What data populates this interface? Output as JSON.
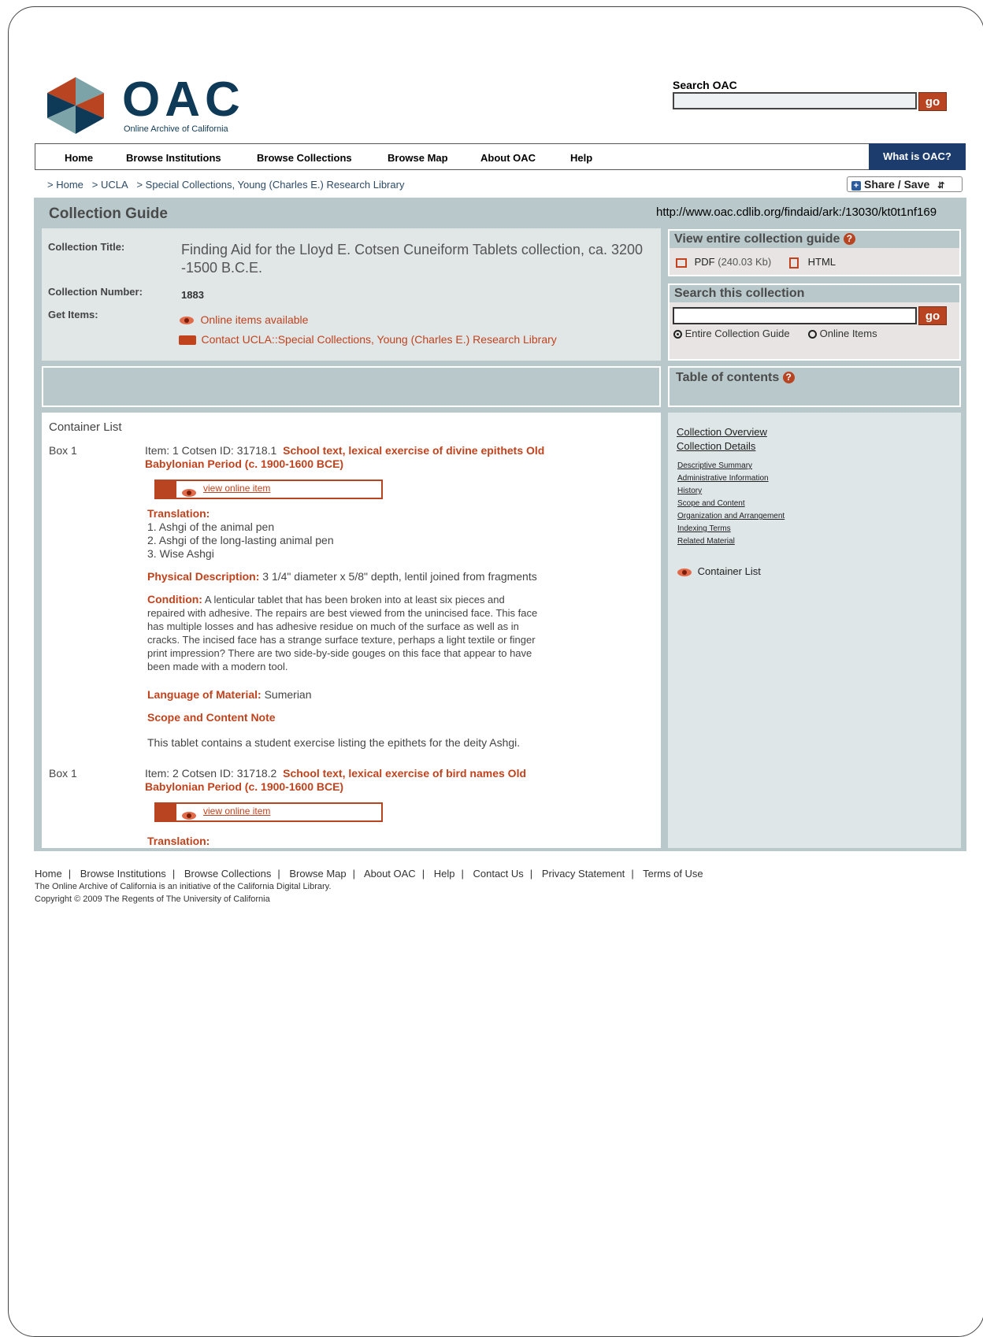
{
  "header": {
    "logo_text": "OAC",
    "logo_subtitle": "Online Archive of California",
    "search_label": "Search OAC",
    "search_placeholder": "",
    "go_label": "go"
  },
  "nav": {
    "items": [
      "Home",
      "Browse Institutions",
      "Browse Collections",
      "Browse Map",
      "About OAC",
      "Help"
    ],
    "what_is": "What is OAC?"
  },
  "breadcrumb": [
    "> Home",
    "> UCLA",
    "> Special Collections, Young (Charles E.) Research Library"
  ],
  "share_label": "Share / Save",
  "guide": {
    "heading": "Collection Guide",
    "url": "http://www.oac.cdlib.org/findaid/ark:/13030/kt0t1nf169",
    "title_label": "Collection Title:",
    "title_value": "Finding Aid for the Lloyd E. Cotsen Cuneiform Tablets collection, ca. 3200 -1500 B.C.E.",
    "number_label": "Collection Number:",
    "number_value": "1883",
    "get_items_label": "Get Items:",
    "online_items": "Online items available",
    "contact": "Contact UCLA::Special Collections, Young (Charles E.) Research Library"
  },
  "view_guide": {
    "heading": "View entire collection guide",
    "pdf_label": "PDF",
    "pdf_size": "(240.03 Kb)",
    "html_label": "HTML"
  },
  "search_collection": {
    "heading": "Search this collection",
    "go_label": "go",
    "option1": "Entire Collection Guide",
    "option2": "Online Items"
  },
  "toc": {
    "heading": "Table of contents",
    "overview": "Collection Overview",
    "details": "Collection Details",
    "sub_items": [
      "Descriptive Summary",
      "Administrative Information",
      "History",
      "Scope and Content",
      "Organization and Arrangement",
      "Indexing Terms",
      "Related Material"
    ],
    "container_list": "Container List"
  },
  "container": {
    "heading": "Container List",
    "items": [
      {
        "box": "Box 1",
        "item_prefix": "Item: 1 Cotsen ID: 31718.1",
        "title_line1": "School text, lexical exercise of divine epithets Old",
        "title_line2": "Babylonian Period (c. 1900-1600 BCE)",
        "view_label": "view online item",
        "translation_label": "Translation:",
        "translation_lines": [
          "1. Ashgi of the animal pen",
          "2. Ashgi of the long-lasting animal pen",
          "3. Wise Ashgi"
        ],
        "physical_label": "Physical Description:",
        "physical_value": "3 1/4\" diameter x 5/8\" depth, lentil joined from fragments",
        "condition_label": "Condition:",
        "condition_lines": [
          "A lenticular tablet that has been broken into at least six pieces and",
          "repaired with adhesive. The repairs are best viewed from the unincised face. This face",
          "has multiple losses and has adhesive residue on much of the surface as well as in",
          "cracks. The incised face has a strange surface texture, perhaps a light textile or finger",
          "print impression? There are two side-by-side gouges on this face that appear to have",
          "been made with a modern tool."
        ],
        "language_label": "Language of Material:",
        "language_value": "Sumerian",
        "scope_label": "Scope and Content Note",
        "scope_value": "This tablet contains a student exercise listing the epithets for the deity Ashgi."
      },
      {
        "box": "Box 1",
        "item_prefix": "Item: 2 Cotsen ID: 31718.2",
        "title_line1": "School text, lexical exercise of bird names Old",
        "title_line2": "Babylonian Period (c. 1900-1600 BCE)",
        "view_label": "view online item",
        "translation_label": "Translation:"
      }
    ]
  },
  "footer": {
    "links": [
      "Home",
      "Browse Institutions",
      "Browse Collections",
      "Browse Map",
      "About OAC",
      "Help",
      "Contact Us",
      "Privacy Statement",
      "Terms of Use"
    ],
    "note1": "The Online Archive of California is an initiative of the California Digital Library.",
    "note2": "Copyright © 2009 The Regents of The University of California"
  }
}
